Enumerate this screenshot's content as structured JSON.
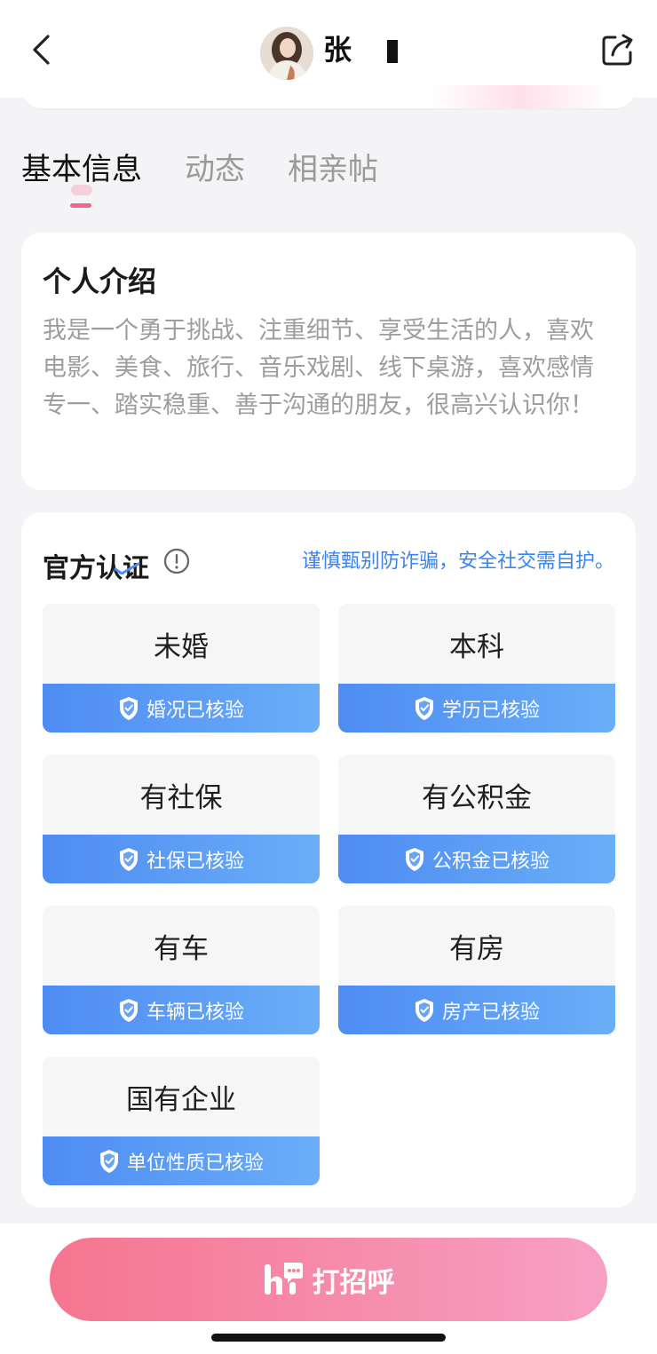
{
  "header": {
    "name": "张"
  },
  "tabs": [
    {
      "label": "基本信息",
      "active": true
    },
    {
      "label": "动态",
      "active": false
    },
    {
      "label": "相亲帖",
      "active": false
    }
  ],
  "intro": {
    "title": "个人介绍",
    "text": "我是一个勇于挑战、注重细节、享受生活的人，喜欢电影、美食、旅行、音乐戏剧、线下桌游，喜欢感情专一、踏实稳重、善于沟通的朋友，很高兴认识你！"
  },
  "certification": {
    "title": "官方认证",
    "warning": "谨慎甄别防诈骗，安全社交需自护。",
    "items": [
      {
        "value": "未婚",
        "badge": "婚况已核验"
      },
      {
        "value": "本科",
        "badge": "学历已核验"
      },
      {
        "value": "有社保",
        "badge": "社保已核验"
      },
      {
        "value": "有公积金",
        "badge": "公积金已核验"
      },
      {
        "value": "有车",
        "badge": "车辆已核验"
      },
      {
        "value": "有房",
        "badge": "房产已核验"
      },
      {
        "value": "国有企业",
        "badge": "单位性质已核验"
      }
    ]
  },
  "action": {
    "greet_label": "打招呼"
  },
  "colors": {
    "accent_pink": "#f2658f",
    "badge_blue": "#4e8cf3",
    "warning_blue": "#3a84f0"
  }
}
